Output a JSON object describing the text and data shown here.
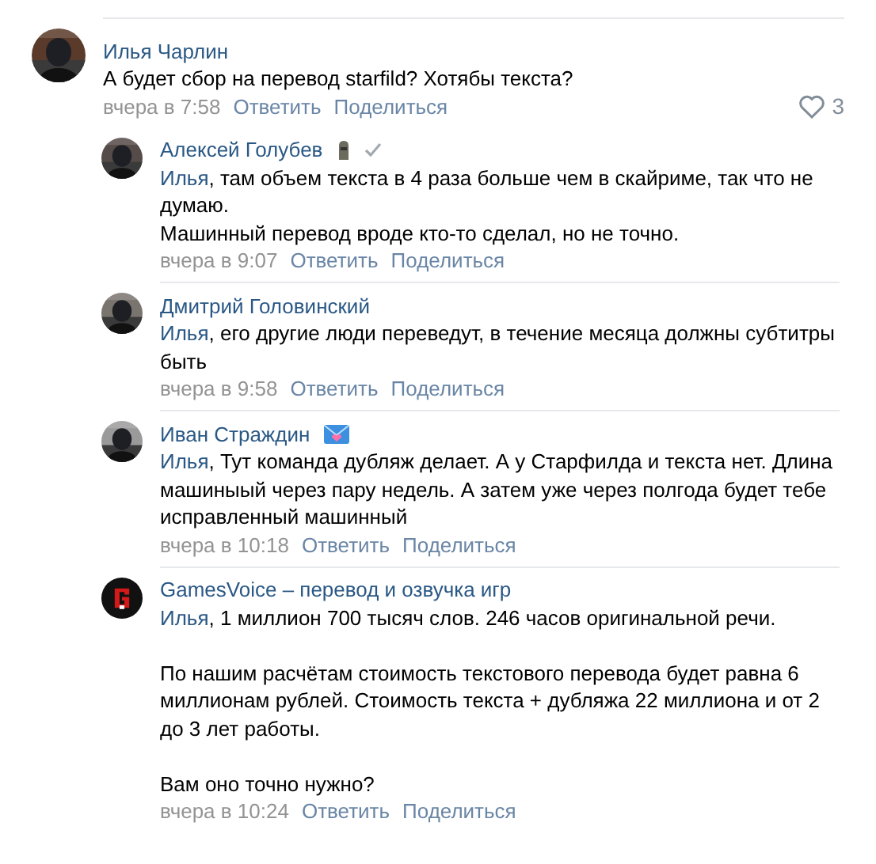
{
  "comments": [
    {
      "author": "Илья Чарлин",
      "kind": "root",
      "avatar": {
        "kind": "picture"
      },
      "text": "А будет сбор на перевод starfild? Хотябы текста?",
      "time": "вчера в 7:58",
      "reply": "Ответить",
      "share": "Поделиться",
      "likes": "3"
    },
    {
      "author": "Алексей Голубев",
      "kind": "reply",
      "avatar": {
        "kind": "picture"
      },
      "badges": [
        {
          "kind": "statue"
        },
        {
          "kind": "check"
        }
      ],
      "mention": "Илья",
      "text": ", там объем текста в 4 раза больше чем в скайриме, так что не думаю.\nМашинный перевод вроде кто-то сделал, но не точно.",
      "time": "вчера в 9:07",
      "reply": "Ответить",
      "share": "Поделиться"
    },
    {
      "author": "Дмитрий Головинский",
      "kind": "reply",
      "avatar": {
        "kind": "picture"
      },
      "mention": "Илья",
      "text": ", его другие люди переведут, в течение месяца должны субтитры быть",
      "time": "вчера в 9:58",
      "reply": "Ответить",
      "share": "Поделиться"
    },
    {
      "author": "Иван Страждин",
      "kind": "reply",
      "avatar": {
        "kind": "picture"
      },
      "badges": [
        {
          "kind": "envelope"
        }
      ],
      "mention": "Илья",
      "text": ", Тут команда дубляж делает. А у Старфилда и текста нет. Длина машиныый через пару недель. А затем уже через полгода будет тебе исправленный машинный",
      "time": "вчера в 10:18",
      "reply": "Ответить",
      "share": "Поделиться"
    },
    {
      "author": "GamesVoice – перевод и озвучка игр",
      "kind": "reply",
      "avatar": {
        "kind": "logo"
      },
      "mention": "Илья",
      "text": ", 1 миллион 700 тысяч слов. 246 часов оригинальной речи.\n\nПо нашим расчётам стоимость текстового перевода будет равна 6 миллионам рублей. Стоимость текста + дубляжа 22 миллиона и от 2 до 3 лет работы.\n\nВам оно точно нужно?",
      "time": "вчера в 10:24",
      "reply": "Ответить",
      "share": "Поделиться"
    }
  ]
}
